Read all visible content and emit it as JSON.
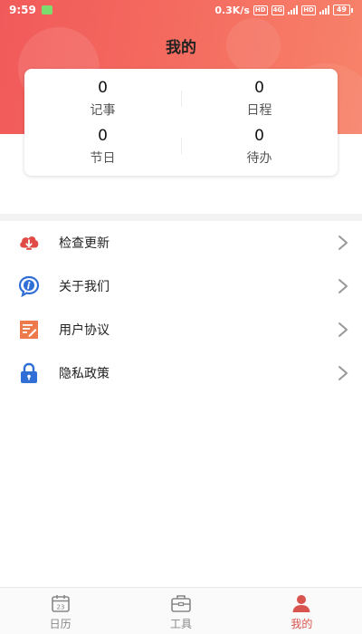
{
  "status_bar": {
    "time": "9:59",
    "net_speed": "0.3K/s",
    "hd": "HD",
    "net_type": "4G",
    "battery": "49"
  },
  "header": {
    "title": "我的"
  },
  "stats": [
    {
      "value": "0",
      "label": "记事"
    },
    {
      "value": "0",
      "label": "日程"
    },
    {
      "value": "0",
      "label": "节日"
    },
    {
      "value": "0",
      "label": "待办"
    }
  ],
  "menu": [
    {
      "label": "检查更新",
      "icon": "cloud-download-icon"
    },
    {
      "label": "关于我们",
      "icon": "info-bubble-icon"
    },
    {
      "label": "用户协议",
      "icon": "document-edit-icon"
    },
    {
      "label": "隐私政策",
      "icon": "lock-icon"
    }
  ],
  "tabs": [
    {
      "label": "日历",
      "icon": "calendar-icon",
      "active": false,
      "day": "23"
    },
    {
      "label": "工具",
      "icon": "toolbox-icon",
      "active": false
    },
    {
      "label": "我的",
      "icon": "user-icon",
      "active": true
    }
  ],
  "colors": {
    "header_gradient_start": "#f15a5a",
    "header_gradient_end": "#f7836a",
    "active_tab": "#d9534f",
    "icon_red": "#e04b45",
    "icon_blue": "#2f6fd6",
    "icon_orange": "#ec7a4a"
  }
}
